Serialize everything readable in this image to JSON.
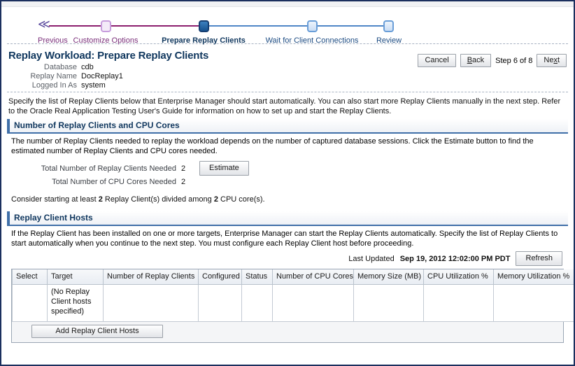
{
  "train": {
    "previous_label": "Previous",
    "previous_icon": "double-chevron-left-icon",
    "steps": [
      {
        "label": "Customize Options",
        "state": "done"
      },
      {
        "label": "Prepare Replay Clients",
        "state": "current"
      },
      {
        "label": "Wait for Client Connections",
        "state": "todo"
      },
      {
        "label": "Review",
        "state": "todo"
      }
    ]
  },
  "header": {
    "title": "Replay Workload: Prepare Replay Clients",
    "fields": [
      {
        "label": "Database",
        "value": "cdb"
      },
      {
        "label": "Replay Name",
        "value": "DocReplay1"
      },
      {
        "label": "Logged In As",
        "value": "system"
      }
    ],
    "cancel_label": "Cancel",
    "back_label": "Back",
    "back_label_pre": "B",
    "back_label_post": "ack",
    "step_text": "Step 6 of 8",
    "next_label_pre": "Ne",
    "next_label_mid": "x",
    "next_label_post": "t"
  },
  "intro": "Specify the list of Replay Clients below that Enterprise Manager should start automatically. You can also start more Replay Clients manually in the next step.  Refer to the Oracle Real Application Testing User's Guide for information on how to set up and start the Replay Clients.",
  "clients_section": {
    "title": "Number of Replay Clients and CPU Cores",
    "description": "The number of Replay Clients needed to replay the workload depends on the number of captured database sessions. Click the Estimate button to find the estimated number of Replay Clients and CPU cores needed.",
    "totals": [
      {
        "label": "Total Number of Replay Clients Needed",
        "value": "2"
      },
      {
        "label": "Total Number of CPU Cores Needed",
        "value": "2"
      }
    ],
    "estimate_label": "Estimate",
    "consider_pre": "Consider starting at least ",
    "consider_clients": "2",
    "consider_mid": " Replay Client(s) divided among ",
    "consider_cores": "2",
    "consider_post": " CPU core(s)."
  },
  "hosts_section": {
    "title": "Replay Client Hosts",
    "description": "If the Replay Client has been installed on one or more targets, Enterprise Manager can start the Replay Clients automatically. Specify the list of Replay Clients to start automatically when you continue to the next step. You must configure each Replay Client host before proceeding.",
    "last_updated_label": "Last Updated",
    "last_updated_value": "Sep 19, 2012 12:02:00 PM PDT",
    "refresh_label": "Refresh",
    "columns": [
      "Select",
      "Target",
      "Number of Replay Clients",
      "Configured",
      "Status",
      "Number of CPU Cores",
      "Memory Size (MB)",
      "CPU Utilization %",
      "Memory Utilization %"
    ],
    "empty_row_text": "(No Replay Client hosts specified)",
    "add_hosts_label": "Add Replay Client Hosts"
  },
  "colors": {
    "frame_border": "#1b2f5e",
    "accent_blue": "#3f6fa8",
    "title_blue": "#10375e",
    "train_done": "#8c1f6e",
    "train_todo": "#4f86c6"
  }
}
